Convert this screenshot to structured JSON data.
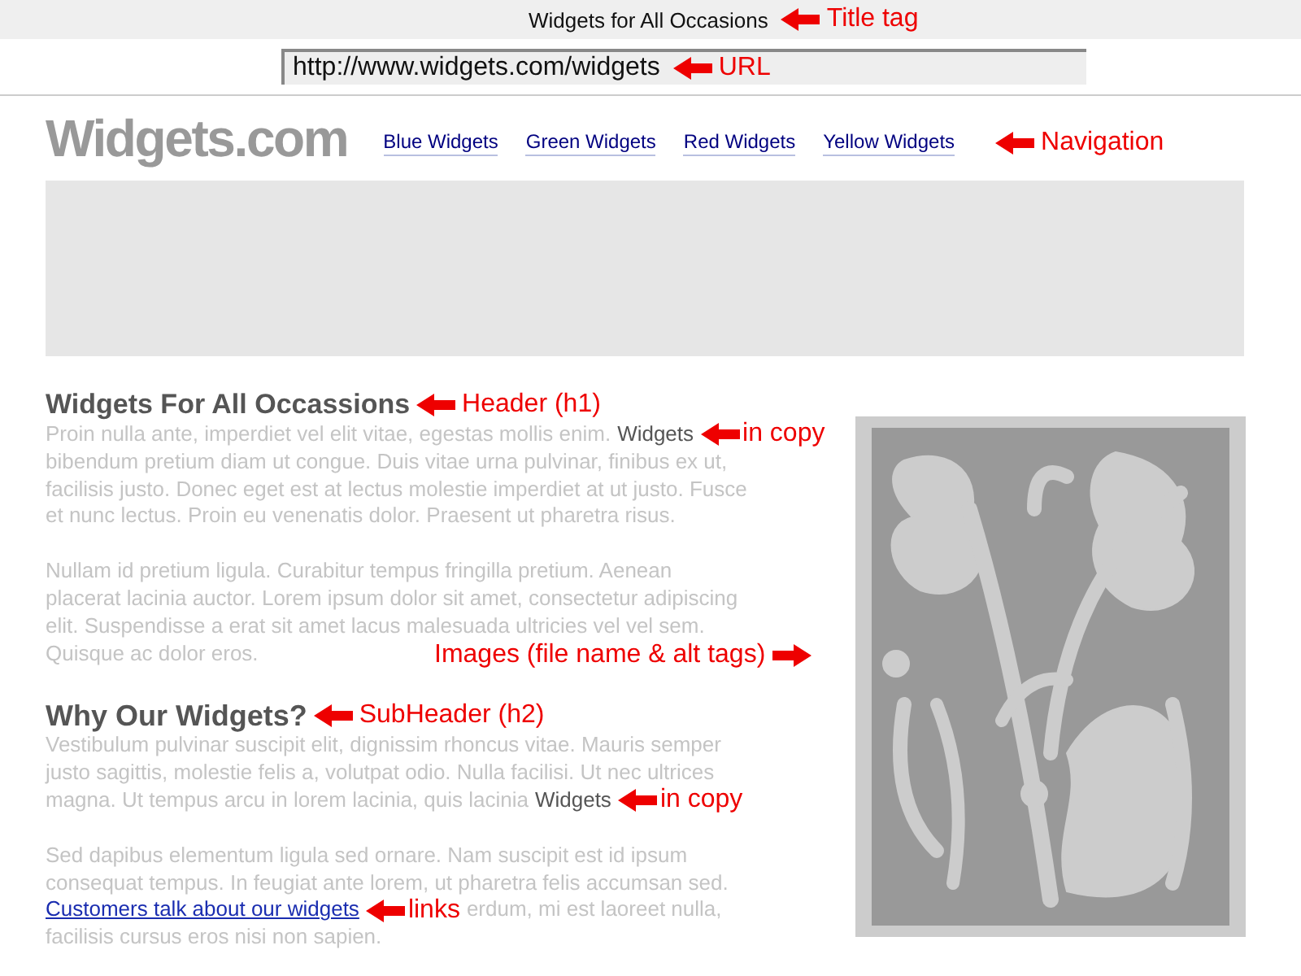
{
  "title_bar": {
    "title": "Widgets for All Occasions",
    "callout": "Title tag"
  },
  "address_bar": {
    "url": "http://www.widgets.com/widgets",
    "callout": "URL"
  },
  "site": {
    "logo": "Widgets.com",
    "nav_callout": "Navigation",
    "nav": [
      {
        "label": "Blue Widgets"
      },
      {
        "label": "Green Widgets"
      },
      {
        "label": "Red Widgets"
      },
      {
        "label": "Yellow Widgets"
      }
    ]
  },
  "sections": [
    {
      "kind": "header",
      "heading": "Widgets For All Occassions",
      "callout": "Header (h1)",
      "paragraphs": [
        [
          [
            {
              "kind": "copy",
              "text": "Proin nulla ante, imperdiet vel elit vitae, egestas mollis enim."
            },
            {
              "kind": "keyword",
              "text": "Widgets"
            },
            {
              "kind": "callout",
              "text": "in copy"
            }
          ],
          [
            {
              "kind": "copy",
              "text": "bibendum pretium diam ut congue. Duis vitae urna pulvinar, finibus ex ut,"
            }
          ],
          [
            {
              "kind": "copy",
              "text": "facilisis justo. Donec eget est at lectus molestie imperdiet at ut justo. Fusce"
            }
          ],
          [
            {
              "kind": "copy",
              "text": "et nunc lectus. Proin eu venenatis dolor. Praesent ut pharetra risus."
            }
          ]
        ],
        [
          [
            {
              "kind": "copy",
              "text": "Nullam id pretium ligula. Curabitur tempus fringilla pretium. Aenean"
            }
          ],
          [
            {
              "kind": "copy",
              "text": "placerat lacinia auctor. Lorem ipsum dolor sit amet, consectetur adipiscing"
            }
          ],
          [
            {
              "kind": "copy",
              "text": "elit. Suspendisse a erat sit amet lacus malesuada ultricies vel vel sem."
            }
          ],
          [
            {
              "kind": "copy",
              "text": "Quisque ac dolor eros."
            }
          ]
        ]
      ]
    },
    {
      "kind": "subheader",
      "heading": "Why Our Widgets?",
      "callout": "SubHeader (h2)",
      "paragraphs": [
        [
          [
            {
              "kind": "copy",
              "text": "Vestibulum pulvinar suscipit elit, dignissim  rhoncus vitae. Mauris semper"
            }
          ],
          [
            {
              "kind": "copy",
              "text": "justo sagittis, molestie felis a, volutpat odio. Nulla facilisi. Ut nec ultrices"
            }
          ],
          [
            {
              "kind": "copy",
              "text": "magna. Ut tempus arcu in lorem lacinia, quis lacinia"
            },
            {
              "kind": "keyword",
              "text": "Widgets"
            },
            {
              "kind": "callout",
              "text": "in copy"
            }
          ]
        ],
        [
          [
            {
              "kind": "copy",
              "text": "Sed dapibus elementum ligula sed ornare. Nam suscipit est id ipsum"
            }
          ],
          [
            {
              "kind": "copy",
              "text": "consequat tempus. In feugiat ante lorem, ut pharetra felis accumsan sed."
            }
          ],
          [
            {
              "kind": "link",
              "text": "Customers talk about our widgets"
            },
            {
              "kind": "callout",
              "text": "links"
            },
            {
              "kind": "copy",
              "text": "erdum, mi est laoreet nulla,"
            }
          ],
          [
            {
              "kind": "copy",
              "text": "facilisis cursus eros nisi non sapien."
            }
          ]
        ]
      ]
    }
  ],
  "image": {
    "kind": "picture",
    "callout": "Images (file name & alt tags)"
  }
}
